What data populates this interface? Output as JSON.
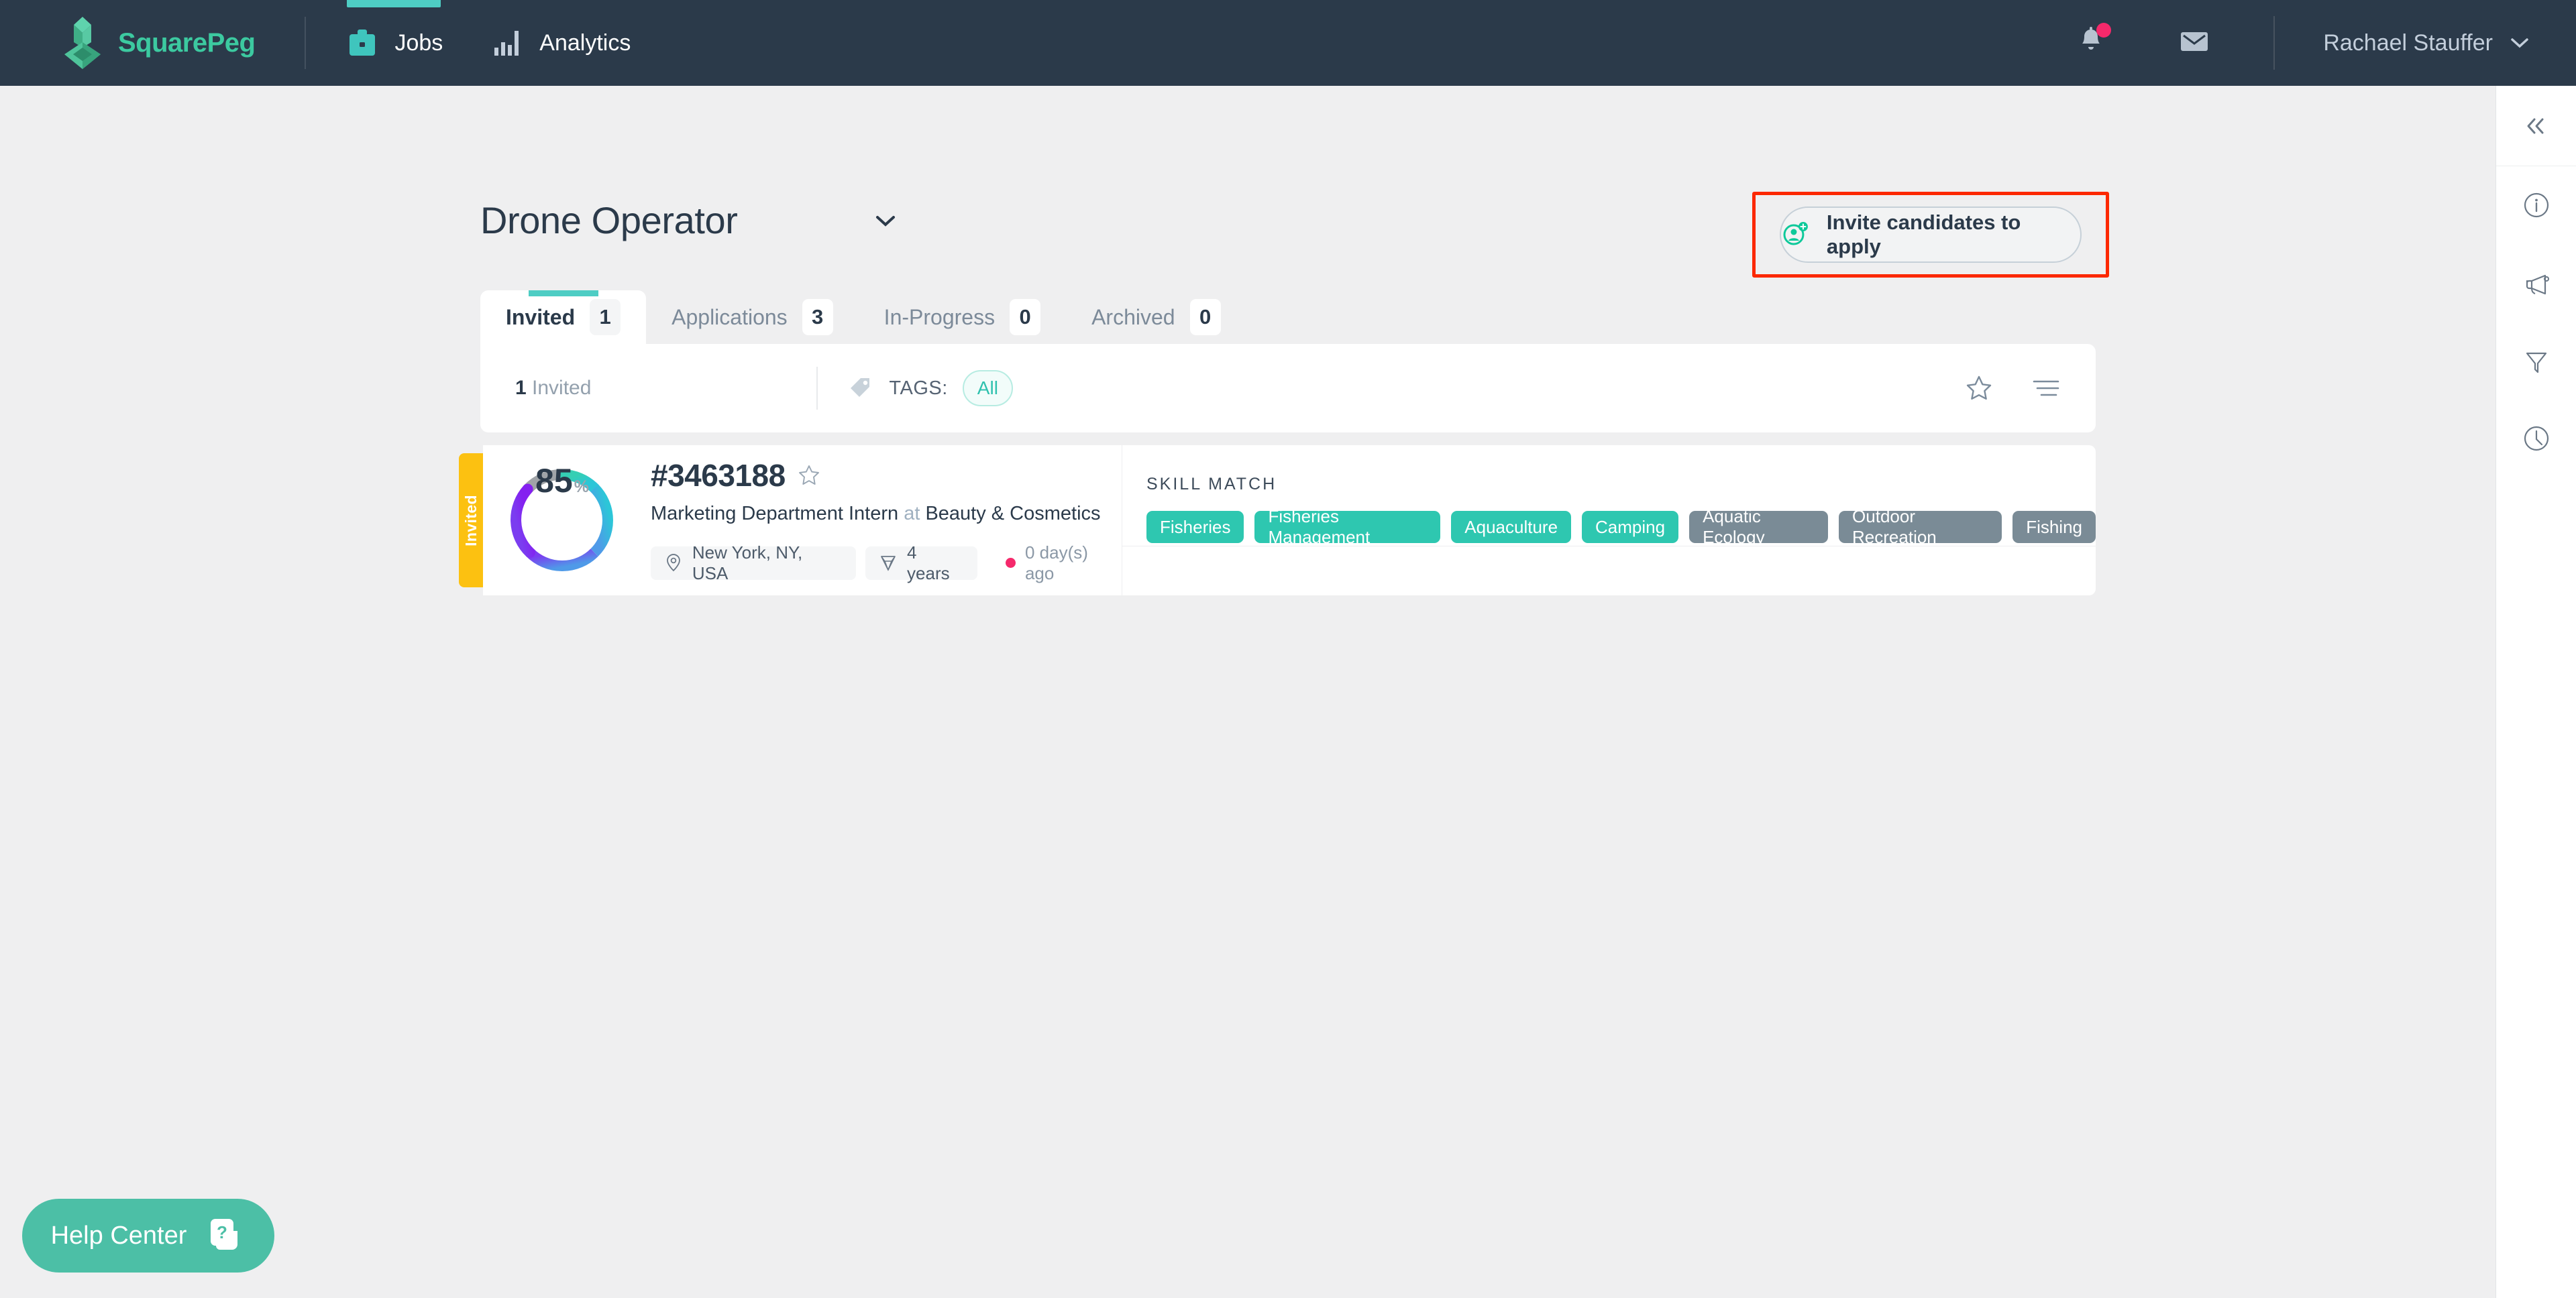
{
  "topnav": {
    "brand": "SquarePeg",
    "items": [
      {
        "label": "Jobs",
        "icon": "briefcase-icon",
        "active": true
      },
      {
        "label": "Analytics",
        "icon": "bar-chart-icon",
        "active": false
      }
    ],
    "notifications_icon": "bell-icon",
    "messages_icon": "envelope-icon",
    "user_name": "Rachael Stauffer",
    "user_chevron": "chevron-down-icon",
    "accent_color": "#4ecdc4",
    "background_color": "#2b3a4a",
    "badge_color": "#f5296b"
  },
  "header": {
    "job_title": "Drone Operator",
    "job_dropdown_icon": "chevron-down-icon",
    "invite_button_label": "Invite candidates to apply",
    "invite_button_icon": "user-add-icon",
    "highlight_color": "#fc2800"
  },
  "tabs": [
    {
      "label": "Invited",
      "count": "1",
      "active": true
    },
    {
      "label": "Applications",
      "count": "3",
      "active": false
    },
    {
      "label": "In-Progress",
      "count": "0",
      "active": false
    },
    {
      "label": "Archived",
      "count": "0",
      "active": false
    }
  ],
  "filterbar": {
    "count_number": "1",
    "count_label": "Invited",
    "tags_icon": "tag-icon",
    "tags_label": "TAGS:",
    "tags_value": "All",
    "star_icon": "star-outline-icon",
    "sort_icon": "sort-lines-icon"
  },
  "candidate": {
    "status_label": "Invited",
    "status_color": "#fcc111",
    "score": "85",
    "score_unit": "%",
    "score_gap_color": "#a0a4a8",
    "id": "#3463188",
    "favorite_icon": "star-outline-icon",
    "role": "Marketing Department Intern",
    "at_word": "at",
    "company": "Beauty & Cosmetics",
    "location_icon": "map-pin-icon",
    "location": "New York, NY, USA",
    "experience_icon": "diamond-icon",
    "experience": "4 years",
    "recency": "0 day(s) ago",
    "skill_match_heading": "SKILL MATCH",
    "skills": [
      {
        "label": "Fisheries",
        "matched": true
      },
      {
        "label": "Fisheries Management",
        "matched": true
      },
      {
        "label": "Aquaculture",
        "matched": true
      },
      {
        "label": "Camping",
        "matched": true
      },
      {
        "label": "Aquatic Ecology",
        "matched": false
      },
      {
        "label": "Outdoor Recreation",
        "matched": false
      },
      {
        "label": "Fishing",
        "matched": false
      }
    ],
    "match_color": "#2ec7b0",
    "nomatch_color": "#7a8b96"
  },
  "rail": {
    "collapse_icon": "double-chevron-left-icon",
    "items": [
      {
        "icon": "info-circle-icon"
      },
      {
        "icon": "megaphone-icon"
      },
      {
        "icon": "filter-funnel-icon"
      },
      {
        "icon": "clock-icon"
      }
    ]
  },
  "help": {
    "label": "Help Center",
    "icon": "help-cards-icon",
    "color": "#4cbfa6"
  }
}
